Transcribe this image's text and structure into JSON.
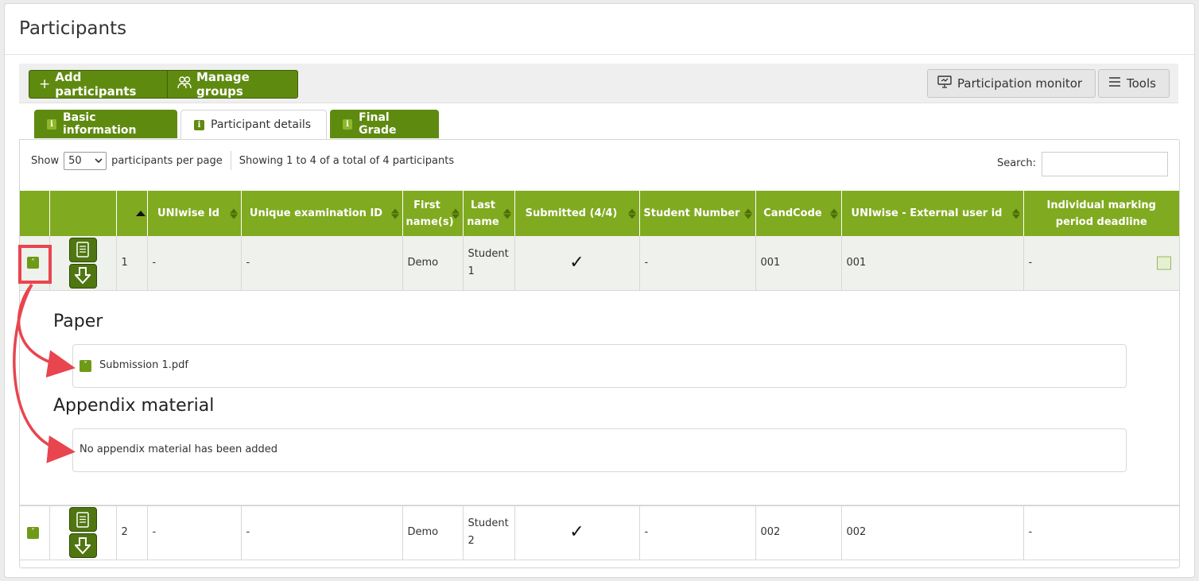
{
  "page": {
    "title": "Participants"
  },
  "toolbar": {
    "add_label": "Add participants",
    "groups_label": "Manage groups",
    "monitor_label": "Participation monitor",
    "tools_label": "Tools"
  },
  "tabs": [
    {
      "label": "Basic information"
    },
    {
      "label": "Participant details"
    },
    {
      "label": "Final Grade"
    }
  ],
  "listing": {
    "show_label": "Show",
    "per_page": "50",
    "per_page_suffix": "participants per page",
    "summary": "Showing 1 to 4 of a total of 4 participants",
    "search_label": "Search:"
  },
  "table": {
    "headers": [
      "UNIwise Id",
      "Unique examination ID",
      "First name(s)",
      "Last name",
      "Submitted (4/4)",
      "Student Number",
      "CandCode",
      "UNIwise - External user id",
      "Individual marking period deadline"
    ],
    "rows": [
      {
        "no": "1",
        "uniwise_id": "-",
        "unique_exam_id": "-",
        "first": "Demo",
        "last": "Student 1",
        "student_number": "-",
        "candcode": "001",
        "external_id": "001",
        "deadline": "-"
      },
      {
        "no": "2",
        "uniwise_id": "-",
        "unique_exam_id": "-",
        "first": "Demo",
        "last": "Student 2",
        "student_number": "-",
        "candcode": "002",
        "external_id": "002",
        "deadline": "-"
      }
    ]
  },
  "detail": {
    "paper_title": "Paper",
    "paper_file": "Submission 1.pdf",
    "appendix_title": "Appendix material",
    "appendix_empty": "No appendix material has been added"
  },
  "colors": {
    "brand_green": "#5f8a10",
    "header_green": "#80aa20",
    "annotation_red": "#e8454f"
  }
}
